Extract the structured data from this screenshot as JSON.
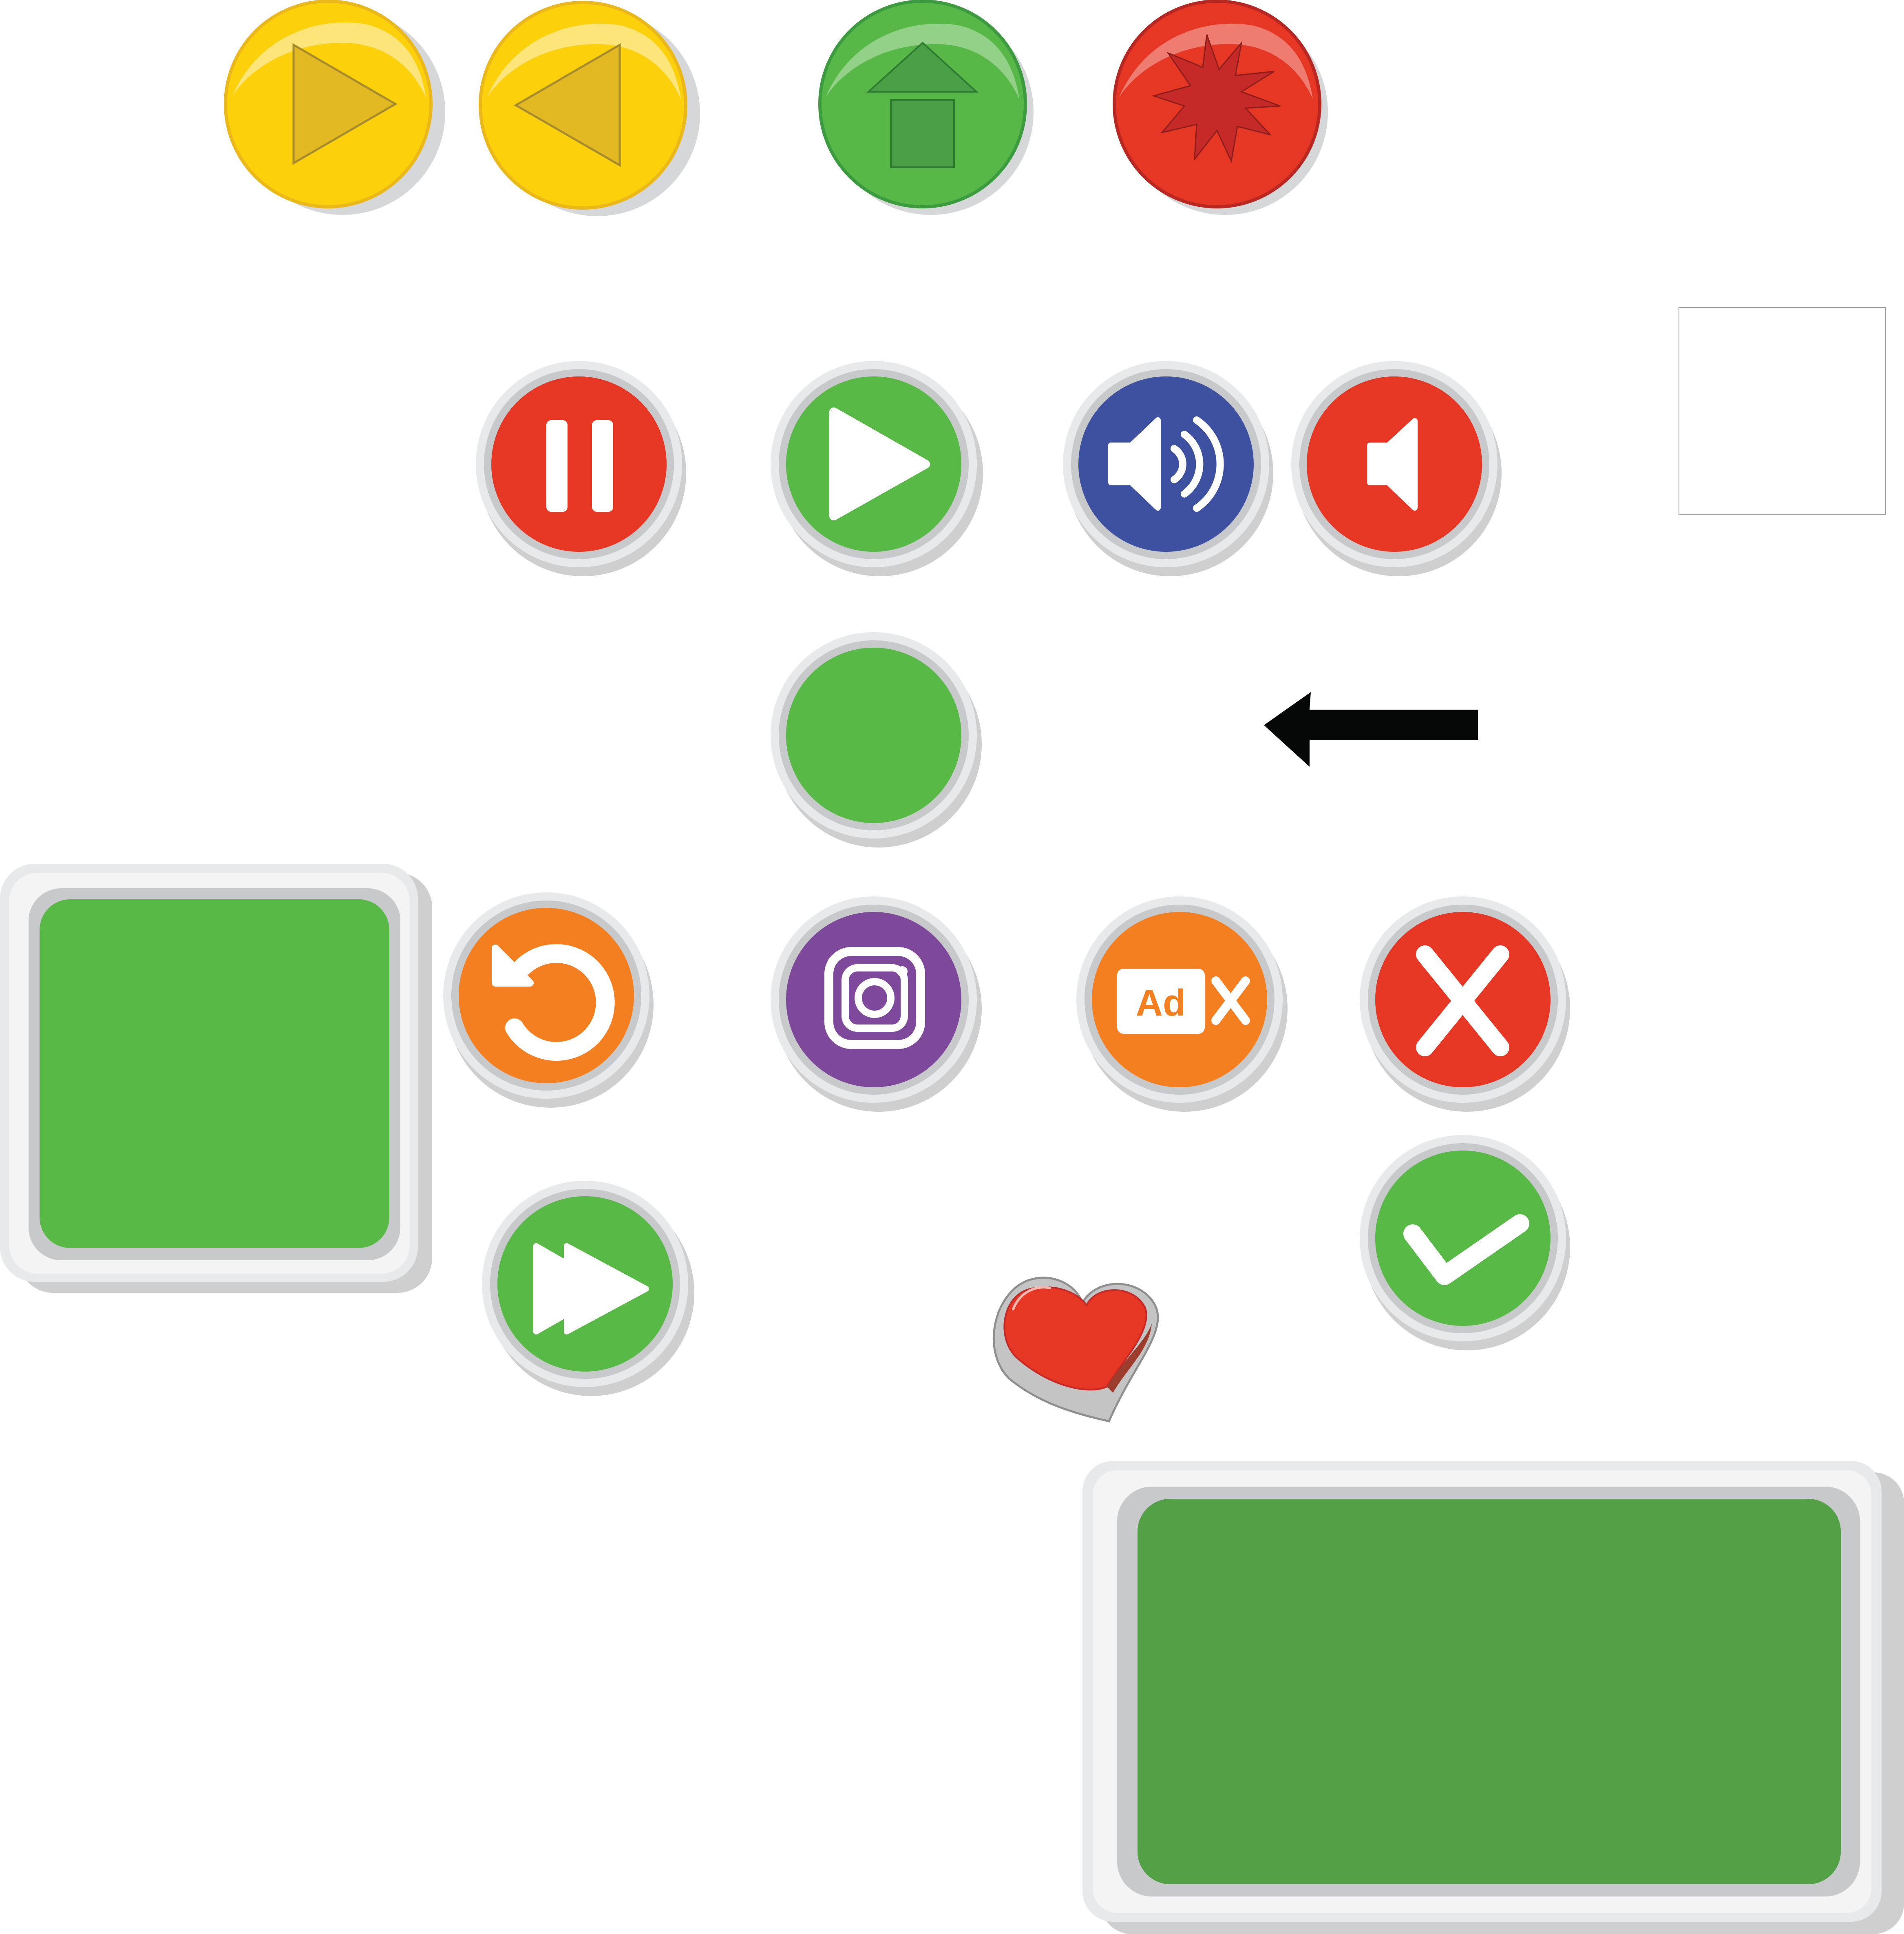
{
  "colors": {
    "yellow": "#fcd00b",
    "yellow_dark": "#e2b922",
    "green_glossy": "#58b847",
    "green_dark": "#4a9e45",
    "red_glossy": "#e63624",
    "red_dark": "#c52a28",
    "red": "#e63624",
    "green": "#58b947",
    "blue": "#3e51a0",
    "orange": "#f47f20",
    "purple": "#7f499b",
    "panel_green": "#54a046",
    "bezel_light": "#e8e9eb",
    "bezel_mid": "#c8c9cb",
    "shadow": "#cfcfd0",
    "arrow": "#050707"
  },
  "glossy_buttons": [
    {
      "icon": "play-right-icon",
      "color": "yellow"
    },
    {
      "icon": "play-left-icon",
      "color": "yellow"
    },
    {
      "icon": "upload-arrow-icon",
      "color": "green"
    },
    {
      "icon": "burst-icon",
      "color": "red"
    }
  ],
  "round_buttons": [
    {
      "icon": "pause-icon",
      "color": "red"
    },
    {
      "icon": "play-icon",
      "color": "green"
    },
    {
      "icon": "volume-on-icon",
      "color": "blue"
    },
    {
      "icon": "volume-mute-icon",
      "color": "red"
    },
    {
      "icon": "blank",
      "color": "green"
    },
    {
      "icon": "restart-icon",
      "color": "orange"
    },
    {
      "icon": "instagram-icon",
      "color": "purple"
    },
    {
      "icon": "remove-ads-icon",
      "color": "orange"
    },
    {
      "icon": "close-icon",
      "color": "red"
    },
    {
      "icon": "fast-forward-icon",
      "color": "green"
    },
    {
      "icon": "checkmark-icon",
      "color": "green"
    }
  ],
  "ad_badge": {
    "text": "Ad"
  },
  "extras": [
    "heart-icon",
    "back-arrow-icon",
    "empty-frame"
  ],
  "panels": [
    "square-green-panel",
    "wide-green-panel"
  ]
}
